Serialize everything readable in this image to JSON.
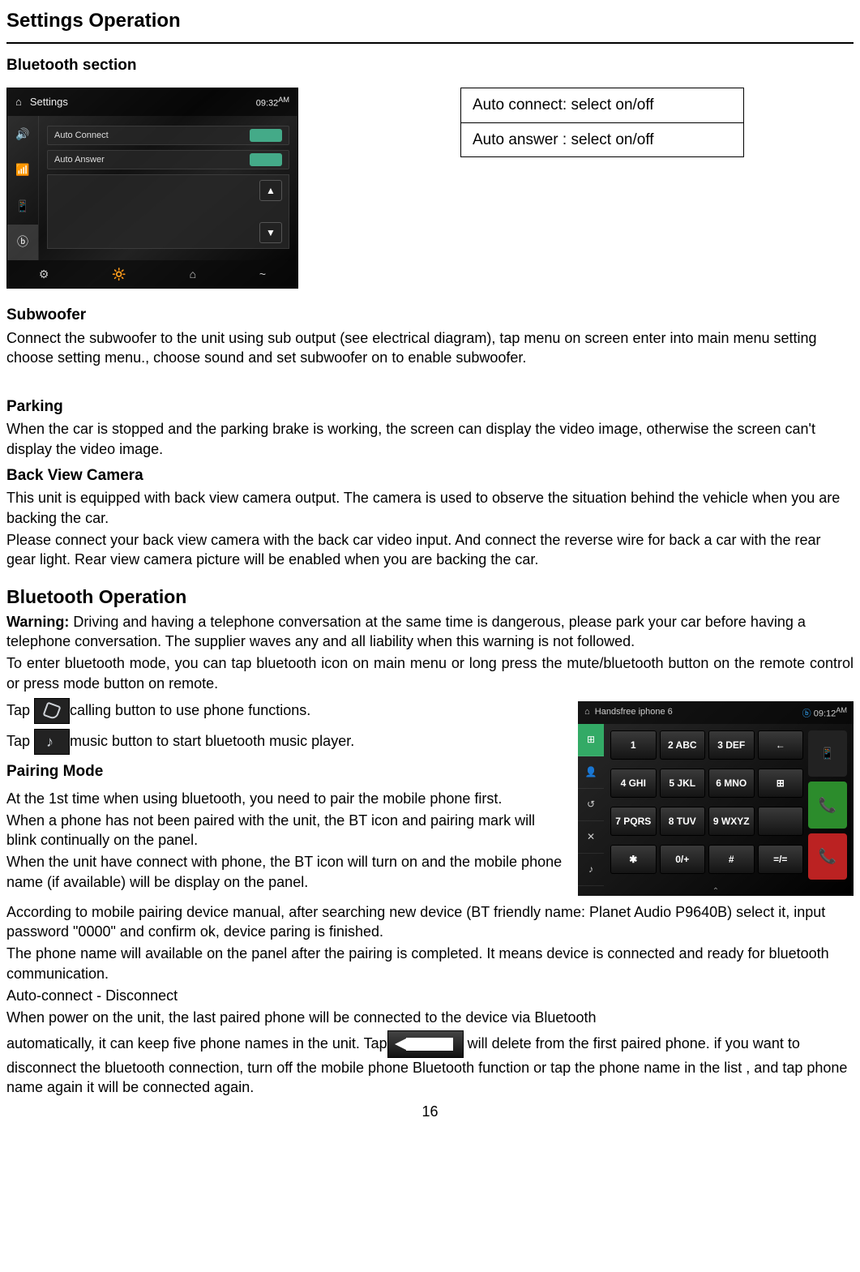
{
  "page": {
    "title": "Settings Operation",
    "section1": "Bluetooth section",
    "page_number": "16"
  },
  "screenshot1": {
    "back": "⌂",
    "title": "Settings",
    "time": "09:32",
    "ampm": "AM",
    "opt1": "Auto Connect",
    "opt2": "Auto Answer",
    "sideicons": [
      "🔊",
      "📶",
      "📱",
      "ⓑ"
    ],
    "bottom": [
      "⚙",
      "🔆",
      "⌂",
      "~"
    ]
  },
  "infobox": {
    "r1": "Auto connect: select on/off",
    "r2": "Auto answer : select on/off"
  },
  "subwoofer": {
    "h": "Subwoofer",
    "p": "Connect the subwoofer to the unit using sub output (see electrical diagram), tap menu on screen enter into main menu setting choose setting menu., choose sound and set subwoofer on to enable subwoofer."
  },
  "parking": {
    "h": "Parking",
    "p": "When the car is stopped and the parking brake is working, the screen can display the video image, otherwise the screen can't display the video image."
  },
  "backcam": {
    "h": "Back View Camera",
    "p1": "This unit is equipped with back view camera output. The camera is used to observe the situation behind the vehicle when you are backing the car.",
    "p2": "Please connect your back view camera with the back car video input. And connect the reverse wire for back a car with the rear gear light. Rear view camera picture will be enabled when you are backing the car."
  },
  "btop": {
    "h": "Bluetooth Operation",
    "warn_label": "Warning:",
    "warn": " Driving and having a telephone conversation at the same time is dangerous, please park your car before having a telephone conversation. The supplier waves any and all liability when this warning is not followed.",
    "enter": "To enter bluetooth mode, you can tap bluetooth icon on main menu or long press the mute/bluetooth button on the remote control or press mode button on remote.",
    "tap_pre": "Tap ",
    "tap1_post": "calling button to use phone functions.",
    "tap2_post": "music button to start bluetooth music player."
  },
  "screenshot2": {
    "title": "Handsfree   iphone 6",
    "time": "09:12",
    "ampm": "AM",
    "keys": [
      "1",
      "2 ABC",
      "3 DEF",
      "←",
      "4 GHI",
      "5 JKL",
      "6 MNO",
      "⊞",
      "7 PQRS",
      "8 TUV",
      "9 WXYZ",
      "",
      "✱",
      "0/+",
      "#",
      "=/="
    ]
  },
  "pairing": {
    "h": "Pairing Mode",
    "p1": "At the 1st time when using bluetooth, you need to pair the mobile phone first.",
    "p2": "When a phone has not been paired with the unit, the BT icon and pairing mark will blink continually on the panel.",
    "p3": "When the unit have connect with phone, the BT icon will turn on and the mobile phone name (if available) will be display on the panel.",
    "p4": "According to mobile pairing device manual, after searching new device (BT friendly name: Planet Audio P9640B) select it, input password \"0000\" and confirm ok, device paring is finished.",
    "p5": "The phone name will available on the panel after the pairing is completed. It means device is connected and ready for bluetooth communication.",
    "auto_h": "Auto-connect - Disconnect",
    "auto1": "When power on the unit, the last paired phone will be connected to the device via Bluetooth",
    "auto2a": "automatically, it can keep five phone names in the unit. Tap",
    "auto2b": " will delete from the first paired phone. if you want to disconnect the bluetooth connection, turn off the mobile phone Bluetooth function or tap the phone name in the list , and tap phone name again it will be connected again."
  }
}
